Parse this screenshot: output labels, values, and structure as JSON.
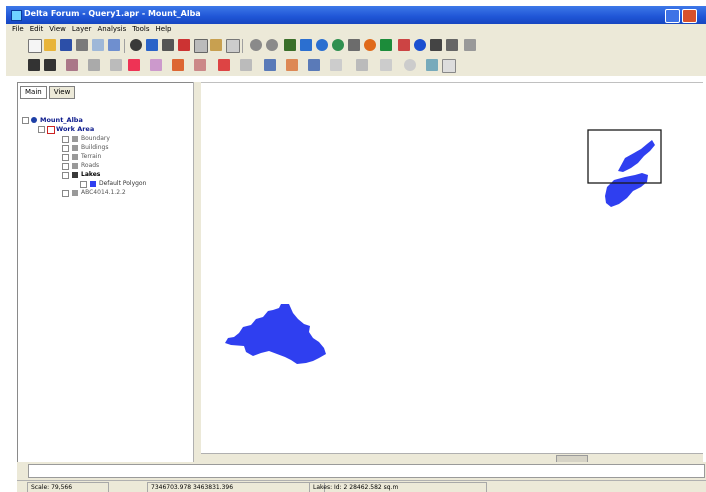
{
  "window": {
    "title": "Delta Forum - Query1.apr - Mount_Alba"
  },
  "menu": [
    "File",
    "Edit",
    "View",
    "Layer",
    "Analysis",
    "Tools",
    "Help"
  ],
  "panel_tabs": [
    "Main",
    "View"
  ],
  "tree": {
    "root": "Mount_Alba",
    "group": "Work Area",
    "layers": [
      "Boundary",
      "Buildings",
      "Terrain",
      "Roads"
    ],
    "selected_layer": "Lakes",
    "legend_item": "Default Polygon",
    "extra_layer": "ABC4014.1.2.2"
  },
  "status": {
    "scale": "Scale: 79,566",
    "coords": "7346703.978  3463831.396",
    "feature": "Lakes: Id: 2  28462.582 sq.m"
  },
  "colors": {
    "lake_fill": "#2f3ff0",
    "title_bar": "#1f55d6",
    "chrome": "#ece9d8"
  }
}
